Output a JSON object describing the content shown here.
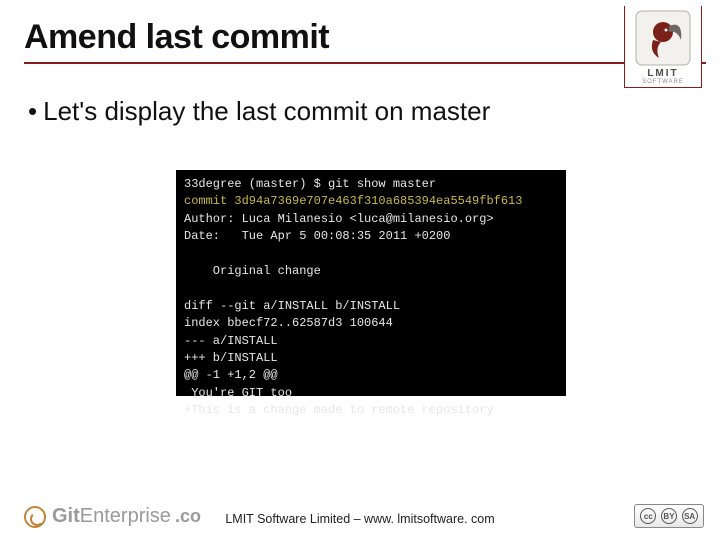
{
  "title": "Amend last commit",
  "bullet_text": "Let's display the last commit on master",
  "logo": {
    "text": "LMIT",
    "sub": "SOFTWARE"
  },
  "terminal": {
    "prompt": "33degree (master) $ git show master",
    "commit": "commit 3d94a7369e707e463f310a685394ea5549fbf613",
    "author": "Author: Luca Milanesio <luca@milanesio.org>",
    "date": "Date:   Tue Apr 5 00:08:35 2011 +0200",
    "msg": "    Original change",
    "diff1": "diff --git a/INSTALL b/INSTALL",
    "diff2": "index bbecf72..62587d3 100644",
    "diff3": "--- a/INSTALL",
    "diff4": "+++ b/INSTALL",
    "hunk": "@@ -1 +1,2 @@",
    "ctx": " You're GIT too",
    "add": "+This is a change made to remote repository"
  },
  "footer": {
    "brand_prefix": "Git",
    "brand_suffix": "Enterprise",
    "domain": ".co",
    "center": "LMIT Software Limited – www. lmitsoftware. com"
  },
  "cc": {
    "a": "cc",
    "b": "BY",
    "c": "SA",
    "la": "",
    "lb": "BY",
    "lc": "SA"
  }
}
